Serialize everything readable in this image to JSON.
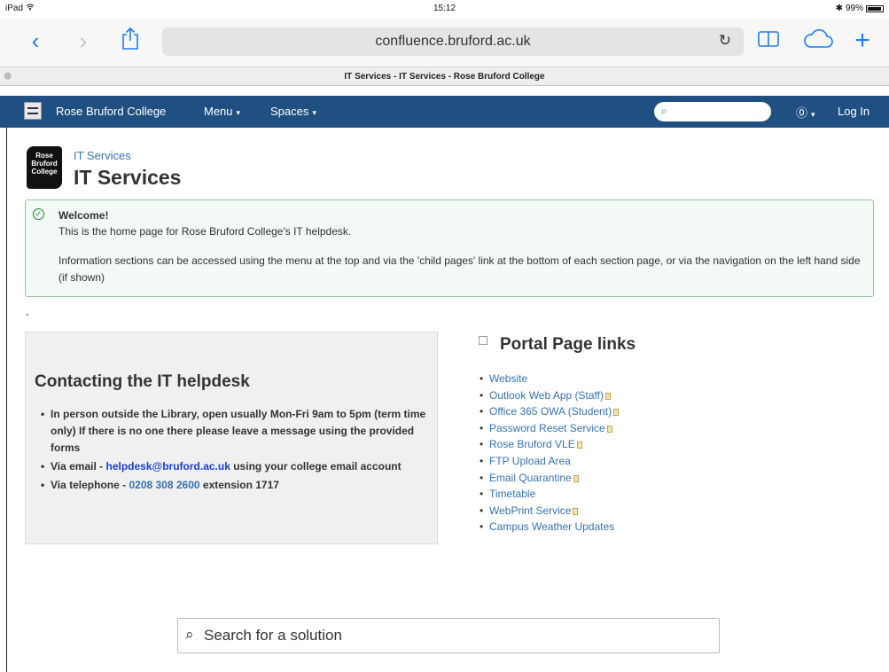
{
  "status_bar": {
    "device": "iPad ",
    "wifi_icon": "wifi-icon",
    "time": "15:12",
    "battery_text": "99%"
  },
  "browser": {
    "back_icon": "‹",
    "forward_icon": "›",
    "share_icon": "⇪",
    "url": "confluence.bruford.ac.uk",
    "reload_icon": "↻",
    "reader_icon": "▭",
    "cloud_icon": "☁",
    "add_icon": "+",
    "tab_close_icon": "⊗",
    "tab_title": "IT Services - IT Services - Rose Bruford College"
  },
  "confluence_header": {
    "site_name": "Rose Bruford College",
    "menu_label": "Menu",
    "spaces_label": "Spaces",
    "caret": "▾",
    "search_placeholder": "",
    "search_icon": "⌕",
    "help_icon": "⓪",
    "login_label": "Log In"
  },
  "space": {
    "logo_text": "Rose Bruford College",
    "breadcrumb": "IT Services",
    "title": "IT Services"
  },
  "welcome": {
    "title": "Welcome!",
    "line1": "This is the home page for Rose Bruford College's IT helpdesk.",
    "line2": "Information sections can be accessed using the menu at the top and via the 'child pages' link at the bottom of each section page, or via the navigation on the left hand side (if shown)"
  },
  "contact": {
    "title": "Contacting the IT helpdesk",
    "item1": "In person outside the Library, open usually Mon-Fri 9am to 5pm (term time only) If there is no one there please leave a message using the provided forms",
    "item2_prefix": "Via email - ",
    "item2_email": "helpdesk@bruford.ac.uk",
    "item2_suffix": " using your college email account",
    "item3_prefix": "Via telephone - ",
    "item3_phone": "0208 308 2600",
    "item3_suffix": " extension 1717"
  },
  "portal": {
    "title": "Portal Page links",
    "links": [
      {
        "label": "Website",
        "external": false
      },
      {
        "label": "Outlook Web App (Staff)",
        "external": true
      },
      {
        "label": "Office 365 OWA (Student)",
        "external": true
      },
      {
        "label": "Password Reset Service",
        "external": true
      },
      {
        "label": "Rose Bruford VLE",
        "external": true
      },
      {
        "label": "FTP Upload Area",
        "external": false
      },
      {
        "label": "Email Quarantine",
        "external": true
      },
      {
        "label": "Timetable",
        "external": false
      },
      {
        "label": "WebPrint Service",
        "external": true
      },
      {
        "label": "Campus Weather Updates",
        "external": false
      }
    ]
  },
  "solution_search": {
    "icon": "⌕",
    "placeholder": "Search for a solution"
  },
  "colors": {
    "header_bg": "#205081",
    "link": "#3572b0",
    "safari_blue": "#1a7cf5",
    "success_border": "#91c89c",
    "success_bg": "#f3f9f4"
  }
}
